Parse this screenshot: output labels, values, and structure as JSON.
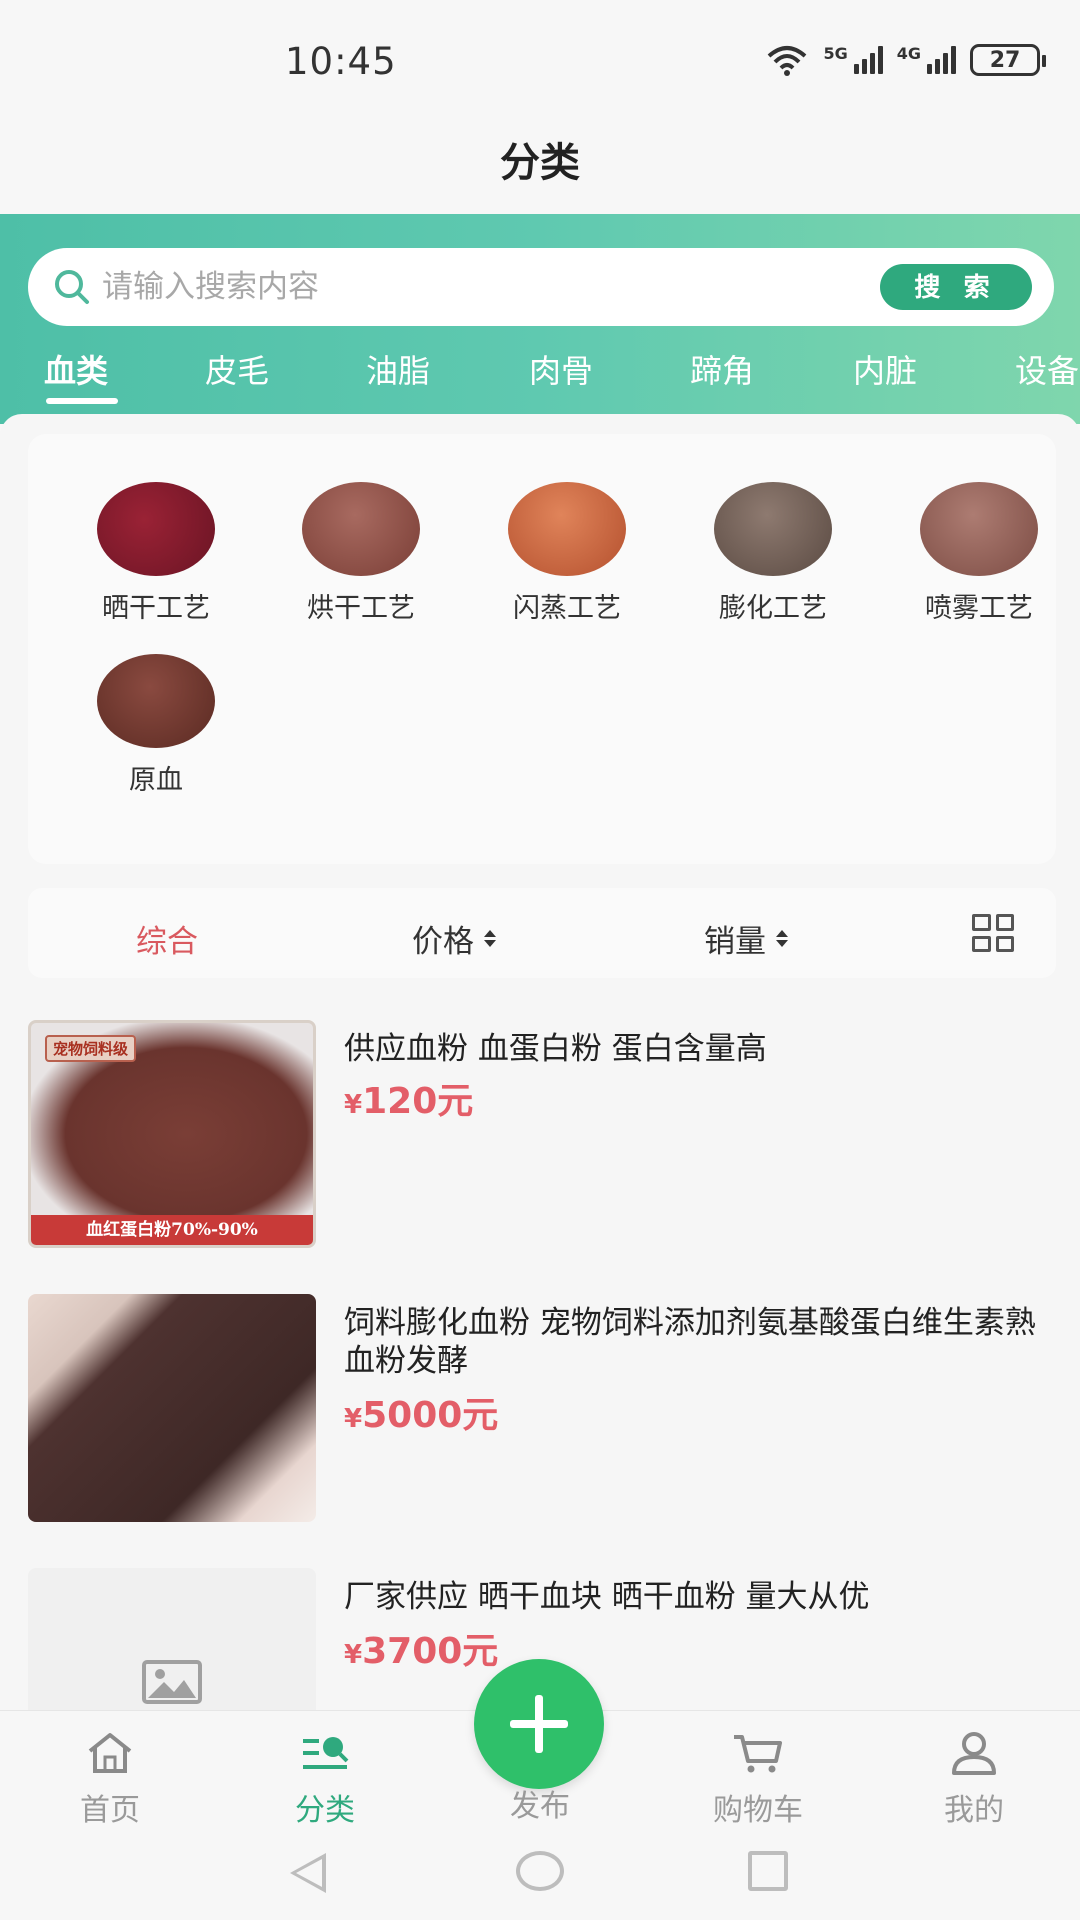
{
  "status_bar": {
    "time": "10:45",
    "network_1": "5G",
    "network_2": "4G",
    "battery": "27"
  },
  "header": {
    "title": "分类"
  },
  "search": {
    "placeholder": "请输入搜索内容",
    "button_label": "搜 索"
  },
  "tabs": [
    {
      "label": "血类",
      "active": true
    },
    {
      "label": "皮毛"
    },
    {
      "label": "油脂"
    },
    {
      "label": "肉骨"
    },
    {
      "label": "蹄角"
    },
    {
      "label": "内脏"
    },
    {
      "label": "设备"
    }
  ],
  "subcategories": [
    {
      "label": "晒干工艺",
      "color": "#7a1a2a"
    },
    {
      "label": "烘干工艺",
      "color": "#8a4a42"
    },
    {
      "label": "闪蒸工艺",
      "color": "#c8603e"
    },
    {
      "label": "膨化工艺",
      "color": "#6e5c54"
    },
    {
      "label": "喷雾工艺",
      "color": "#8c5a52"
    },
    {
      "label": "原血",
      "color": "#6a342c"
    }
  ],
  "sort_bar": {
    "comprehensive": "综合",
    "price": "价格",
    "sales": "销量"
  },
  "products": [
    {
      "title": "供应血粉 血蛋白粉 蛋白含量高",
      "currency": "¥",
      "price": "120元",
      "badge": "宠物饲料级",
      "banner": "血红蛋白粉70%-90%"
    },
    {
      "title": "饲料膨化血粉 宠物饲料添加剂氨基酸蛋白维生素熟血粉发酵",
      "currency": "¥",
      "price": "5000元"
    },
    {
      "title": "厂家供应 晒干血块 晒干血粉 量大从优",
      "currency": "¥",
      "price": "3700元"
    }
  ],
  "bottom_nav": {
    "home": "首页",
    "category": "分类",
    "publish": "发布",
    "cart": "购物车",
    "mine": "我的"
  },
  "colors": {
    "accent": "#2fa97e",
    "price": "#e35e68",
    "active_sort": "#d9595f",
    "publish": "#2fc06a"
  }
}
